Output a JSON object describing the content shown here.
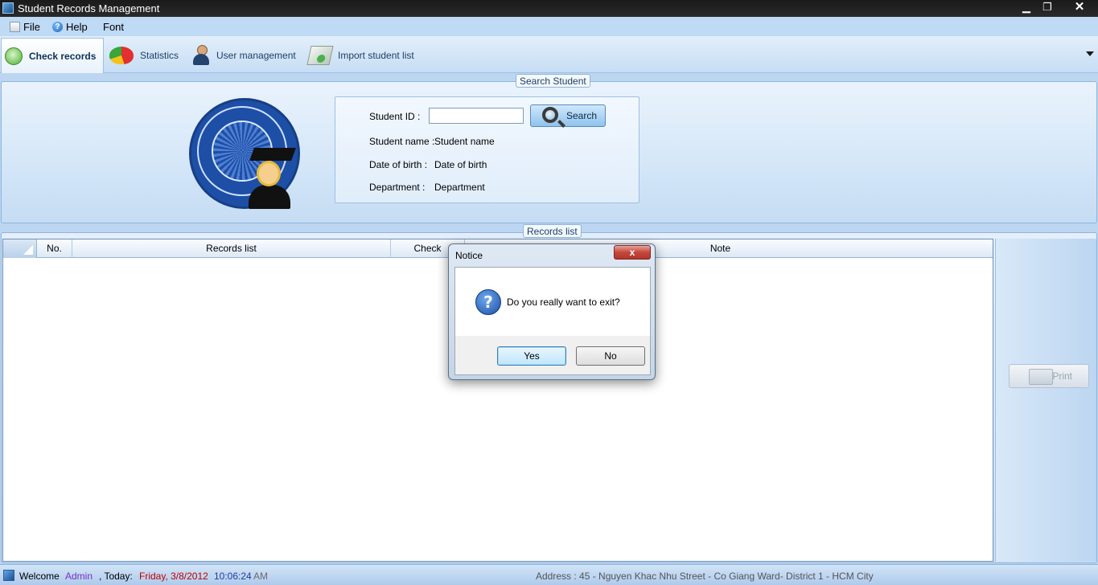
{
  "window": {
    "title": "Student Records Management",
    "minimize": "▁",
    "maximize": "❐",
    "close": "✕"
  },
  "menu": {
    "items": [
      "File",
      "Help",
      "Font"
    ]
  },
  "tabs": [
    {
      "label": "Check records",
      "icon": "check-records-icon",
      "active": true
    },
    {
      "label": "Statistics",
      "icon": "statistics-icon",
      "active": false
    },
    {
      "label": "User management",
      "icon": "user-management-icon",
      "active": false
    },
    {
      "label": "Import student list",
      "icon": "import-icon",
      "active": false
    }
  ],
  "search": {
    "group_label": "Search Student",
    "student_id_label": "Student ID :",
    "student_id_value": "",
    "button": "Search",
    "name_label": "Student name :",
    "name_value": "Student name",
    "dob_label": "Date of birth :",
    "dob_value": "Date of birth",
    "dept_label": "Department :",
    "dept_value": "Department"
  },
  "records": {
    "group_label": "Records list",
    "columns": [
      "No.",
      "Records list",
      "Check",
      "Note"
    ],
    "rows": [],
    "print_button": "Print"
  },
  "dialog": {
    "title": "Notice",
    "close": "x",
    "icon": "question-icon",
    "message": "Do you really want to exit?",
    "yes": "Yes",
    "no": "No"
  },
  "status": {
    "welcome": "Welcome",
    "user": "Admin",
    "today_label": ", Today:",
    "date": "Friday, 3/8/2012",
    "time": "10:06:24",
    "ampm": "AM",
    "address": "Address : 45 - Nguyen Khac Nhu Street - Co Giang Ward- District 1 - HCM City"
  },
  "colors": {
    "user": "#7b2fbf",
    "date": "#c00000",
    "time": "#1f3fa0",
    "ampm": "#6b6b6b",
    "address": "#555555"
  }
}
